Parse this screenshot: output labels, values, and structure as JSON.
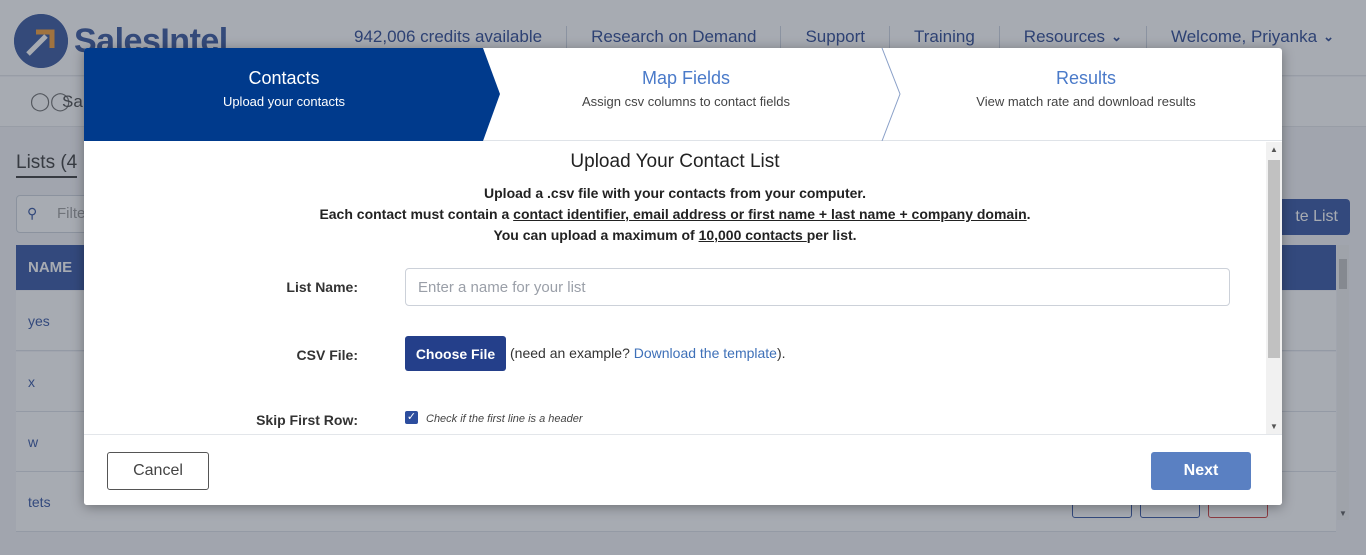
{
  "header": {
    "logo_text": "SalesIntel",
    "nav": [
      {
        "label": "942,006 credits available"
      },
      {
        "label": "Research on Demand"
      },
      {
        "label": "Support"
      },
      {
        "label": "Training"
      },
      {
        "label": "Resources"
      },
      {
        "label": "Welcome, Priyanka"
      }
    ]
  },
  "subnav": {
    "label_fragment": "Sa"
  },
  "page": {
    "lists_title_fragment": "Lists (4",
    "filter_placeholder_fragment": "Filte",
    "create_button_fragment": "te List",
    "table": {
      "column_name": "NAME",
      "rows": [
        {
          "name": "yes"
        },
        {
          "name": "x"
        },
        {
          "name": "w"
        },
        {
          "name": "tets"
        }
      ]
    }
  },
  "modal": {
    "steps": [
      {
        "title": "Contacts",
        "subtitle": "Upload your contacts",
        "active": true
      },
      {
        "title": "Map Fields",
        "subtitle": "Assign csv columns to contact fields",
        "active": false
      },
      {
        "title": "Results",
        "subtitle": "View match rate and download results",
        "active": false
      }
    ],
    "title": "Upload Your Contact List",
    "line1": "Upload a .csv file with your contacts from your computer.",
    "line2_prefix": "Each contact must contain a ",
    "line2_link": "contact identifier, email address or first name + last name + company domain",
    "line2_suffix": ".",
    "line3_prefix": "You can upload a maximum of ",
    "line3_link": "10,000 contacts ",
    "line3_suffix": "per list.",
    "list_name_label": "List Name:",
    "list_name_placeholder": "Enter a name for your list",
    "list_name_value": "",
    "csv_label": "CSV File:",
    "choose_file_label": "Choose File",
    "csv_hint_prefix": "(need an example? ",
    "csv_hint_link": "Download the template",
    "csv_hint_suffix": ").",
    "skip_label": "Skip First Row:",
    "skip_checked": true,
    "skip_note": "Check if the first line is a header",
    "cancel_label": "Cancel",
    "next_label": "Next"
  },
  "colors": {
    "primary": "#003a8c",
    "accent": "#2c4d9e",
    "link": "#3e70b8",
    "next_button": "#5a80c2"
  }
}
